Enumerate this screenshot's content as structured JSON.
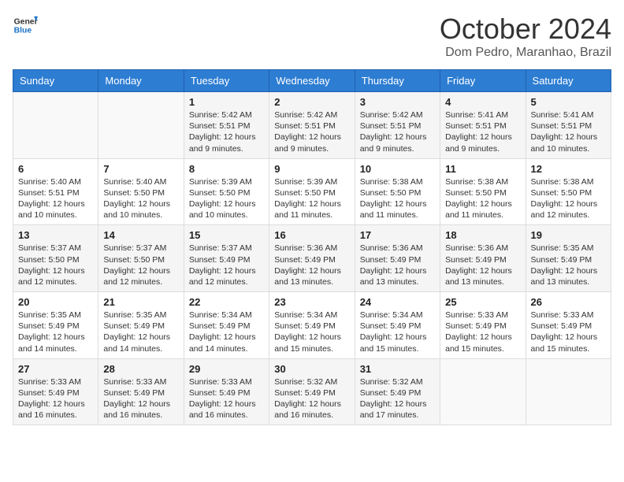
{
  "header": {
    "logo_line1": "General",
    "logo_line2": "Blue",
    "month_title": "October 2024",
    "location": "Dom Pedro, Maranhao, Brazil"
  },
  "weekdays": [
    "Sunday",
    "Monday",
    "Tuesday",
    "Wednesday",
    "Thursday",
    "Friday",
    "Saturday"
  ],
  "weeks": [
    [
      {
        "day": "",
        "info": ""
      },
      {
        "day": "",
        "info": ""
      },
      {
        "day": "1",
        "info": "Sunrise: 5:42 AM\nSunset: 5:51 PM\nDaylight: 12 hours and 9 minutes."
      },
      {
        "day": "2",
        "info": "Sunrise: 5:42 AM\nSunset: 5:51 PM\nDaylight: 12 hours and 9 minutes."
      },
      {
        "day": "3",
        "info": "Sunrise: 5:42 AM\nSunset: 5:51 PM\nDaylight: 12 hours and 9 minutes."
      },
      {
        "day": "4",
        "info": "Sunrise: 5:41 AM\nSunset: 5:51 PM\nDaylight: 12 hours and 9 minutes."
      },
      {
        "day": "5",
        "info": "Sunrise: 5:41 AM\nSunset: 5:51 PM\nDaylight: 12 hours and 10 minutes."
      }
    ],
    [
      {
        "day": "6",
        "info": "Sunrise: 5:40 AM\nSunset: 5:51 PM\nDaylight: 12 hours and 10 minutes."
      },
      {
        "day": "7",
        "info": "Sunrise: 5:40 AM\nSunset: 5:50 PM\nDaylight: 12 hours and 10 minutes."
      },
      {
        "day": "8",
        "info": "Sunrise: 5:39 AM\nSunset: 5:50 PM\nDaylight: 12 hours and 10 minutes."
      },
      {
        "day": "9",
        "info": "Sunrise: 5:39 AM\nSunset: 5:50 PM\nDaylight: 12 hours and 11 minutes."
      },
      {
        "day": "10",
        "info": "Sunrise: 5:38 AM\nSunset: 5:50 PM\nDaylight: 12 hours and 11 minutes."
      },
      {
        "day": "11",
        "info": "Sunrise: 5:38 AM\nSunset: 5:50 PM\nDaylight: 12 hours and 11 minutes."
      },
      {
        "day": "12",
        "info": "Sunrise: 5:38 AM\nSunset: 5:50 PM\nDaylight: 12 hours and 12 minutes."
      }
    ],
    [
      {
        "day": "13",
        "info": "Sunrise: 5:37 AM\nSunset: 5:50 PM\nDaylight: 12 hours and 12 minutes."
      },
      {
        "day": "14",
        "info": "Sunrise: 5:37 AM\nSunset: 5:50 PM\nDaylight: 12 hours and 12 minutes."
      },
      {
        "day": "15",
        "info": "Sunrise: 5:37 AM\nSunset: 5:49 PM\nDaylight: 12 hours and 12 minutes."
      },
      {
        "day": "16",
        "info": "Sunrise: 5:36 AM\nSunset: 5:49 PM\nDaylight: 12 hours and 13 minutes."
      },
      {
        "day": "17",
        "info": "Sunrise: 5:36 AM\nSunset: 5:49 PM\nDaylight: 12 hours and 13 minutes."
      },
      {
        "day": "18",
        "info": "Sunrise: 5:36 AM\nSunset: 5:49 PM\nDaylight: 12 hours and 13 minutes."
      },
      {
        "day": "19",
        "info": "Sunrise: 5:35 AM\nSunset: 5:49 PM\nDaylight: 12 hours and 13 minutes."
      }
    ],
    [
      {
        "day": "20",
        "info": "Sunrise: 5:35 AM\nSunset: 5:49 PM\nDaylight: 12 hours and 14 minutes."
      },
      {
        "day": "21",
        "info": "Sunrise: 5:35 AM\nSunset: 5:49 PM\nDaylight: 12 hours and 14 minutes."
      },
      {
        "day": "22",
        "info": "Sunrise: 5:34 AM\nSunset: 5:49 PM\nDaylight: 12 hours and 14 minutes."
      },
      {
        "day": "23",
        "info": "Sunrise: 5:34 AM\nSunset: 5:49 PM\nDaylight: 12 hours and 15 minutes."
      },
      {
        "day": "24",
        "info": "Sunrise: 5:34 AM\nSunset: 5:49 PM\nDaylight: 12 hours and 15 minutes."
      },
      {
        "day": "25",
        "info": "Sunrise: 5:33 AM\nSunset: 5:49 PM\nDaylight: 12 hours and 15 minutes."
      },
      {
        "day": "26",
        "info": "Sunrise: 5:33 AM\nSunset: 5:49 PM\nDaylight: 12 hours and 15 minutes."
      }
    ],
    [
      {
        "day": "27",
        "info": "Sunrise: 5:33 AM\nSunset: 5:49 PM\nDaylight: 12 hours and 16 minutes."
      },
      {
        "day": "28",
        "info": "Sunrise: 5:33 AM\nSunset: 5:49 PM\nDaylight: 12 hours and 16 minutes."
      },
      {
        "day": "29",
        "info": "Sunrise: 5:33 AM\nSunset: 5:49 PM\nDaylight: 12 hours and 16 minutes."
      },
      {
        "day": "30",
        "info": "Sunrise: 5:32 AM\nSunset: 5:49 PM\nDaylight: 12 hours and 16 minutes."
      },
      {
        "day": "31",
        "info": "Sunrise: 5:32 AM\nSunset: 5:49 PM\nDaylight: 12 hours and 17 minutes."
      },
      {
        "day": "",
        "info": ""
      },
      {
        "day": "",
        "info": ""
      }
    ]
  ]
}
